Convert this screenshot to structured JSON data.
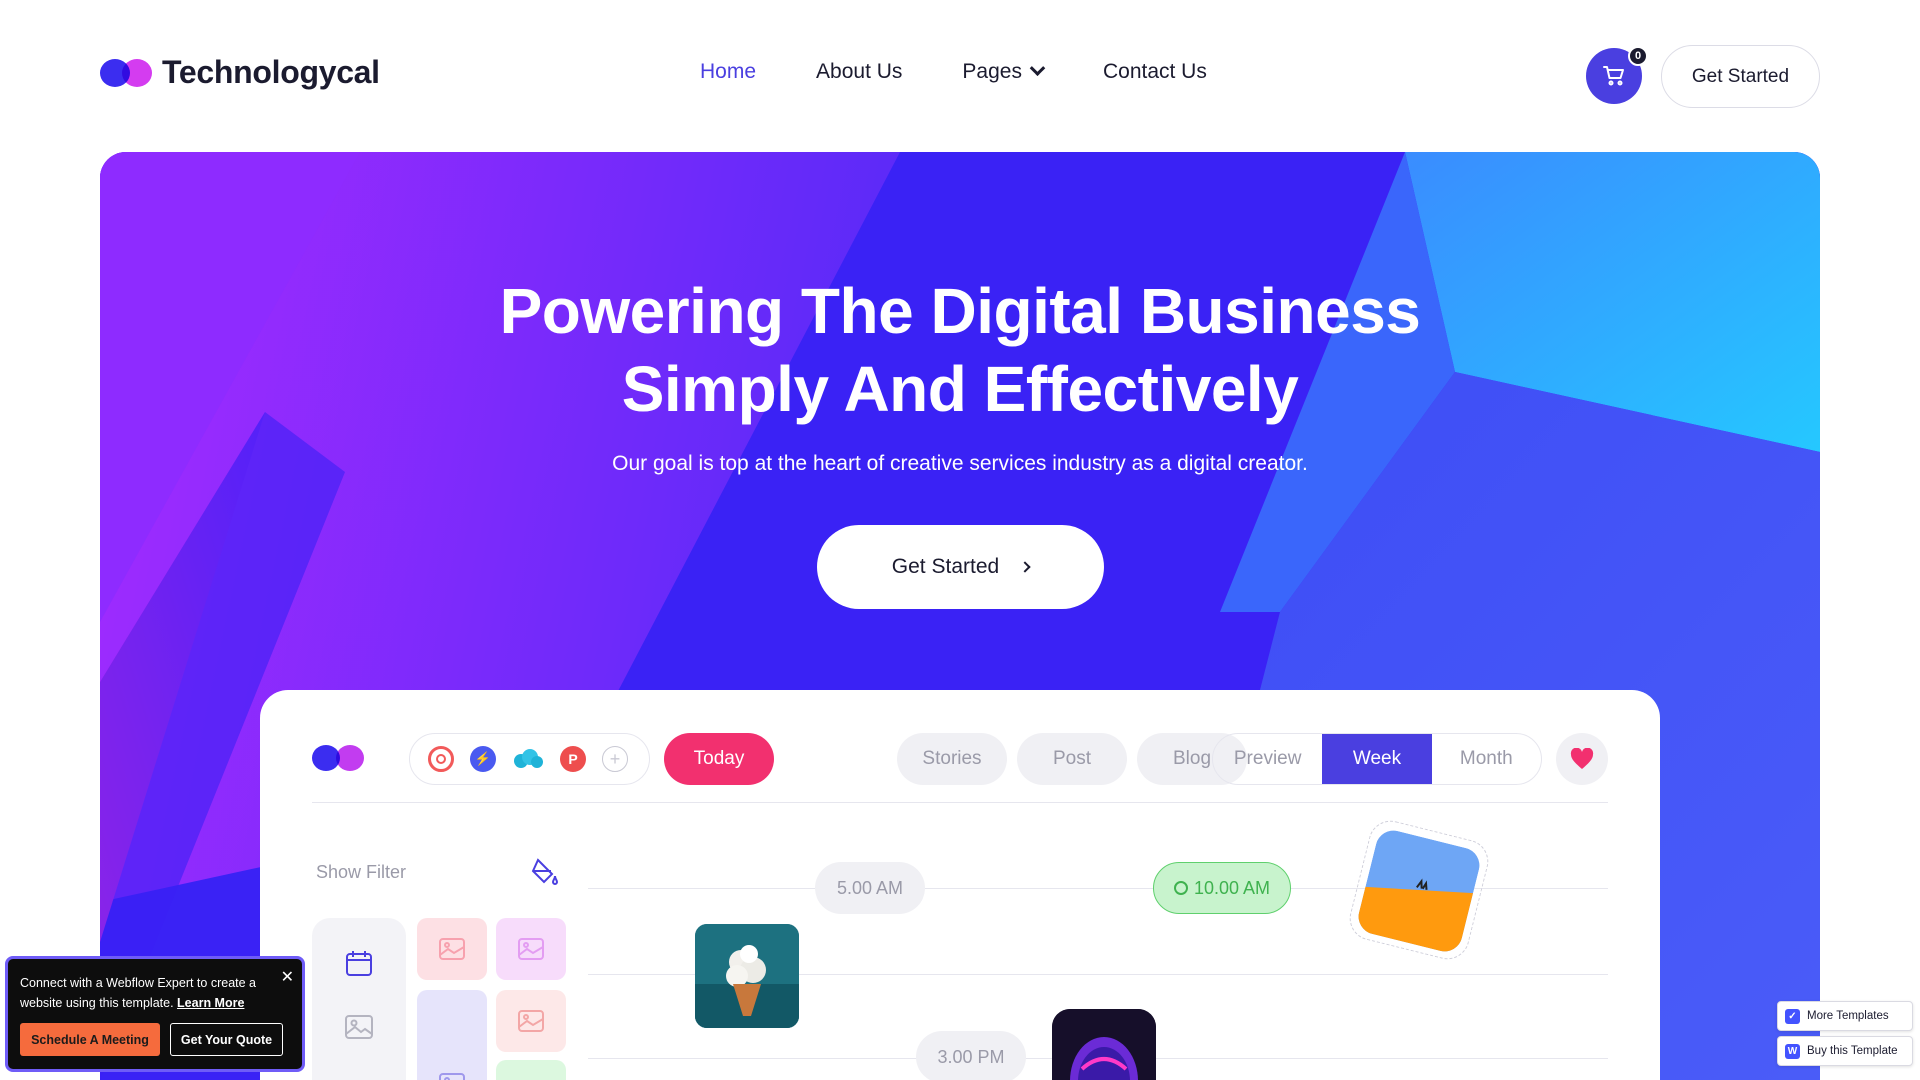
{
  "brand": {
    "name": "Technologycal"
  },
  "nav": {
    "items": [
      {
        "label": "Home",
        "active": true
      },
      {
        "label": "About Us"
      },
      {
        "label": "Pages"
      },
      {
        "label": "Contact Us"
      }
    ],
    "cart_count": "0",
    "cta_label": "Get Started"
  },
  "hero": {
    "title_line1": "Powering The Digital Business",
    "title_line2": "Simply And Effectively",
    "subtitle": "Our goal is top at the heart of creative services industry as a digital creator.",
    "cta_label": "Get Started"
  },
  "dashboard": {
    "today_label": "Today",
    "pills": [
      "Stories",
      "Post",
      "Blog"
    ],
    "views": [
      {
        "label": "Preview",
        "active": false
      },
      {
        "label": "Week",
        "active": true
      },
      {
        "label": "Month",
        "active": false
      }
    ],
    "filter_label": "Show Filter",
    "times": [
      "5.00 AM",
      "10.00 AM",
      "3.00 PM"
    ],
    "app_icons": [
      "target-icon",
      "bolt-icon",
      "cloud-icon",
      "p-icon",
      "plus-icon"
    ]
  },
  "webflow_popup": {
    "text": "Connect with a Webflow Expert to create a website using this template.",
    "link": "Learn More",
    "close": "✕",
    "button_primary": "Schedule A Meeting",
    "button_secondary": "Get Your Quote"
  },
  "template_buttons": {
    "more": "More Templates",
    "buy": "Buy this Template"
  },
  "colors": {
    "accent": "#4a3fe0",
    "pink": "#f2306f",
    "green": "#3fb24f"
  }
}
